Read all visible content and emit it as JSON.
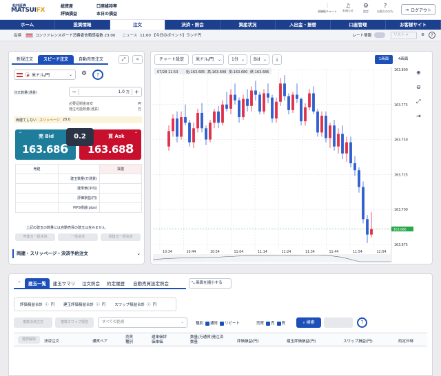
{
  "header": {
    "logo_top": "松井証券",
    "logo_main": "MATSUI",
    "logo_fx": "FX",
    "stats": [
      "総資産",
      "評価損益",
      "口座維持率",
      "本日の損益"
    ],
    "icons": [
      {
        "name": "chart-icon",
        "glyph": "⫶",
        "label": "高機能チャート"
      },
      {
        "name": "bell-icon",
        "glyph": "🔔",
        "label": "お知らせ"
      },
      {
        "name": "gear-icon",
        "glyph": "⚙",
        "label": "設定"
      },
      {
        "name": "help-icon",
        "glyph": "?",
        "label": "お困りのかた"
      }
    ],
    "logout": "ログアウト"
  },
  "nav": [
    "ホーム",
    "投資情報",
    "注文",
    "決済・照会",
    "資産状況",
    "入出金・振替",
    "口座管理",
    "お客様サイト"
  ],
  "ticker": {
    "label": "指標",
    "text": "コンファレンスボード消費者信頼感指数 23:00",
    "news_label": "ニュース",
    "news": "11:00 【今日のポイント】ランド円",
    "rate_info": "レート情報",
    "list_label": "リスト"
  },
  "order": {
    "tabs": [
      "新規注文",
      "スピード注文",
      "自動売買注文"
    ],
    "pair": "米ドル/円",
    "qty_label": "注文数量(通貨)",
    "qty_value": "1.0",
    "qty_unit": "万",
    "margin_label": "必要証拠金目安",
    "margin_unit": "円",
    "orderable_label": "発注可能数量(通貨)",
    "orderable_unit": "万",
    "both_label": "両建てしない",
    "slippage_label": "スリッページ",
    "slippage_value": "20.0",
    "bid_label": "売 Bid",
    "bid_main": "163.68",
    "bid_last": "6",
    "ask_label": "買 Ask",
    "ask_main": "163.68",
    "ask_last": "8",
    "spread": "0.2",
    "col_sell": "売建",
    "col_buy": "買建",
    "rows": [
      "建玉数量(万通貨)",
      "建単価(平均)",
      "評価損益(円)",
      "PIPS損益(pips)"
    ],
    "note": "上記の建玉の数量には自動売買の建玉は含みません",
    "btn_sell_all": "売建玉一括決済",
    "btn_all": "一括決済",
    "btn_buy_all": "買建玉一括決済",
    "section": "両建・スリッページ・決済予約注文"
  },
  "chart_toolbar": {
    "settings": "チャート設定",
    "pair": "米ドル/円",
    "interval": "1分",
    "side": "Bid",
    "one_view": "1画面",
    "four_view": "4画面"
  },
  "chart_data": {
    "type": "candlestick",
    "title": "",
    "info_time": "07/28 11:53",
    "info_values": [
      "始:163.685",
      "高:163.698",
      "安:163.680",
      "終:163.686"
    ],
    "ylim": [
      163.67,
      163.8
    ],
    "y_ticks": [
      "163.800",
      "163.775",
      "163.750",
      "163.725",
      "163.700",
      "163.675"
    ],
    "x_ticks": [
      "10:34",
      "10:44",
      "10:54",
      "11:04",
      "11:14",
      "11:24",
      "11:34",
      "11:44",
      "11:54",
      "12:04"
    ],
    "current_price": "163.686",
    "current_value": 163.686,
    "candles": [
      [
        163.745,
        163.76,
        163.742,
        163.756
      ],
      [
        163.756,
        163.768,
        163.752,
        163.765
      ],
      [
        163.765,
        163.77,
        163.748,
        163.752
      ],
      [
        163.752,
        163.77,
        163.75,
        163.766
      ],
      [
        163.766,
        163.775,
        163.76,
        163.762
      ],
      [
        163.762,
        163.764,
        163.745,
        163.748
      ],
      [
        163.748,
        163.762,
        163.744,
        163.758
      ],
      [
        163.758,
        163.772,
        163.755,
        163.769
      ],
      [
        163.769,
        163.776,
        163.755,
        163.758
      ],
      [
        163.758,
        163.76,
        163.746,
        163.75
      ],
      [
        163.75,
        163.764,
        163.748,
        163.762
      ],
      [
        163.762,
        163.772,
        163.758,
        163.77
      ],
      [
        163.77,
        163.774,
        163.758,
        163.762
      ],
      [
        163.762,
        163.778,
        163.76,
        163.775
      ],
      [
        163.775,
        163.784,
        163.77,
        163.772
      ],
      [
        163.772,
        163.786,
        163.768,
        163.782
      ],
      [
        163.782,
        163.79,
        163.775,
        163.778
      ],
      [
        163.778,
        163.78,
        163.762,
        163.766
      ],
      [
        163.766,
        163.782,
        163.764,
        163.779
      ],
      [
        163.779,
        163.786,
        163.77,
        163.774
      ],
      [
        163.774,
        163.788,
        163.77,
        163.785
      ],
      [
        163.785,
        163.792,
        163.778,
        163.782
      ],
      [
        163.782,
        163.784,
        163.768,
        163.77
      ],
      [
        163.77,
        163.786,
        163.768,
        163.783
      ],
      [
        163.783,
        163.79,
        163.776,
        163.78
      ],
      [
        163.78,
        163.782,
        163.762,
        163.765
      ],
      [
        163.765,
        163.78,
        163.762,
        163.777
      ],
      [
        163.777,
        163.794,
        163.774,
        163.79
      ],
      [
        163.79,
        163.796,
        163.778,
        163.781
      ],
      [
        163.781,
        163.783,
        163.768,
        163.771
      ],
      [
        163.771,
        163.784,
        163.769,
        163.782
      ],
      [
        163.782,
        163.79,
        163.776,
        163.779
      ],
      [
        163.779,
        163.78,
        163.76,
        163.763
      ],
      [
        163.763,
        163.776,
        163.76,
        163.773
      ],
      [
        163.773,
        163.786,
        163.771,
        163.783
      ],
      [
        163.783,
        163.788,
        163.768,
        163.77
      ],
      [
        163.77,
        163.772,
        163.752,
        163.755
      ],
      [
        163.755,
        163.77,
        163.752,
        163.767
      ],
      [
        163.767,
        163.77,
        163.748,
        163.751
      ],
      [
        163.751,
        163.762,
        163.744,
        163.76
      ],
      [
        163.76,
        163.764,
        163.742,
        163.745
      ],
      [
        163.745,
        163.758,
        163.74,
        163.754
      ],
      [
        163.754,
        163.76,
        163.736,
        163.74
      ],
      [
        163.74,
        163.752,
        163.734,
        163.748
      ],
      [
        163.748,
        163.752,
        163.73,
        163.733
      ],
      [
        163.733,
        163.738,
        163.724,
        163.728
      ],
      [
        163.728,
        163.73,
        163.712,
        163.716
      ],
      [
        163.716,
        163.72,
        163.69,
        163.693
      ],
      [
        163.693,
        163.696,
        163.676,
        163.682
      ],
      [
        163.682,
        163.698,
        163.68,
        163.686
      ]
    ]
  },
  "positions": {
    "tabs": [
      "建玉一覧",
      "建玉サマリ",
      "注文照会",
      "約定履歴",
      "自動売買設定照会"
    ],
    "shrink": "画面を縮小する",
    "eval_total": "評価損益合計",
    "pos_eval_total": "建玉評価損益合計",
    "swap_total": "スワップ損益合計",
    "yen": "円",
    "btn_bulk_settle": "複数決済注文",
    "btn_bulk_swap": "複数スワップ振替",
    "filter_all": "すべての銘柄",
    "type_label": "種別",
    "type_normal": "通常",
    "type_repeat": "リピート",
    "side_label": "売買",
    "side_sell": "売",
    "side_buy": "買",
    "search": "検索",
    "columns": [
      "選択解除",
      "決済注文",
      "通貨ペア",
      "売買種別",
      "建単価評価単価",
      "数量(万通貨)発注済数量",
      "評価損益(円)",
      "建玉評価損益(円)",
      "スワップ損益(円)",
      "約定日時"
    ]
  }
}
